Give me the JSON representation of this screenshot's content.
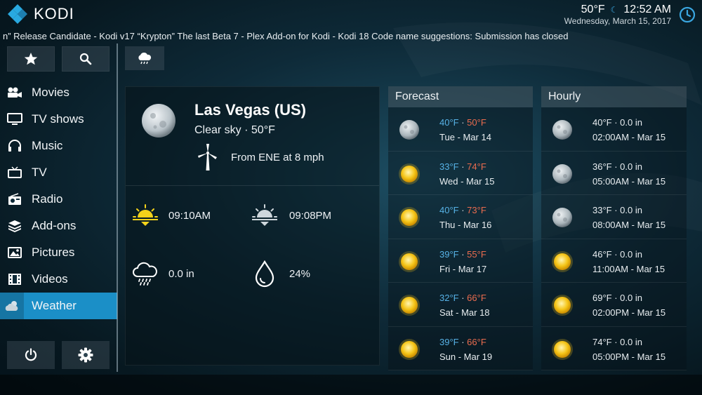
{
  "app": {
    "name": "KODI"
  },
  "status": {
    "temp": "50°F",
    "time": "12:52 AM",
    "date": "Wednesday, March 15, 2017"
  },
  "ticker": "n” Release Candidate - Kodi v17 “Krypton” The last Beta 7 - Plex Add-on for Kodi - Kodi 18 Code name suggestions: Submission has closed",
  "sidebar": {
    "items": [
      {
        "label": "Movies",
        "icon": "movies-icon"
      },
      {
        "label": "TV shows",
        "icon": "tv-shows-icon"
      },
      {
        "label": "Music",
        "icon": "headphones-icon"
      },
      {
        "label": "TV",
        "icon": "tv-icon"
      },
      {
        "label": "Radio",
        "icon": "radio-icon"
      },
      {
        "label": "Add-ons",
        "icon": "addons-icon"
      },
      {
        "label": "Pictures",
        "icon": "pictures-icon"
      },
      {
        "label": "Videos",
        "icon": "videos-icon"
      },
      {
        "label": "Weather",
        "icon": "weather-icon"
      }
    ],
    "active": "Weather"
  },
  "current": {
    "city": "Las Vegas (US)",
    "condition": "Clear sky · 50°F",
    "wind": "From ENE at 8 mph",
    "sunrise": "09:10AM",
    "sunset": "09:08PM",
    "precip": "0.0 in",
    "humidity": "24%"
  },
  "forecast": {
    "title": "Forecast",
    "rows": [
      {
        "lo": "40°F",
        "hi": "50°F",
        "day": "Tue - Mar 14",
        "icon": "moon-icon"
      },
      {
        "lo": "33°F",
        "hi": "74°F",
        "day": "Wed - Mar 15",
        "icon": "sun-icon"
      },
      {
        "lo": "40°F",
        "hi": "73°F",
        "day": "Thu - Mar 16",
        "icon": "sun-icon"
      },
      {
        "lo": "39°F",
        "hi": "55°F",
        "day": "Fri - Mar 17",
        "icon": "sun-icon"
      },
      {
        "lo": "32°F",
        "hi": "66°F",
        "day": "Sat - Mar 18",
        "icon": "sun-icon"
      },
      {
        "lo": "39°F",
        "hi": "66°F",
        "day": "Sun - Mar 19",
        "icon": "sun-icon"
      }
    ]
  },
  "hourly": {
    "title": "Hourly",
    "rows": [
      {
        "line1": "40°F · 0.0 in",
        "line2": "02:00AM - Mar 15",
        "icon": "moon-icon"
      },
      {
        "line1": "36°F · 0.0 in",
        "line2": "05:00AM - Mar 15",
        "icon": "moon-icon"
      },
      {
        "line1": "33°F · 0.0 in",
        "line2": "08:00AM - Mar 15",
        "icon": "moon-icon"
      },
      {
        "line1": "46°F · 0.0 in",
        "line2": "11:00AM - Mar 15",
        "icon": "sun-icon"
      },
      {
        "line1": "69°F · 0.0 in",
        "line2": "02:00PM - Mar 15",
        "icon": "sun-icon"
      },
      {
        "line1": "74°F · 0.0 in",
        "line2": "05:00PM - Mar 15",
        "icon": "sun-icon"
      }
    ]
  },
  "colors": {
    "accent": "#1b8fc7",
    "low_temp": "#57b2e6",
    "high_temp": "#e96b4e",
    "sun": "#f5c518"
  }
}
